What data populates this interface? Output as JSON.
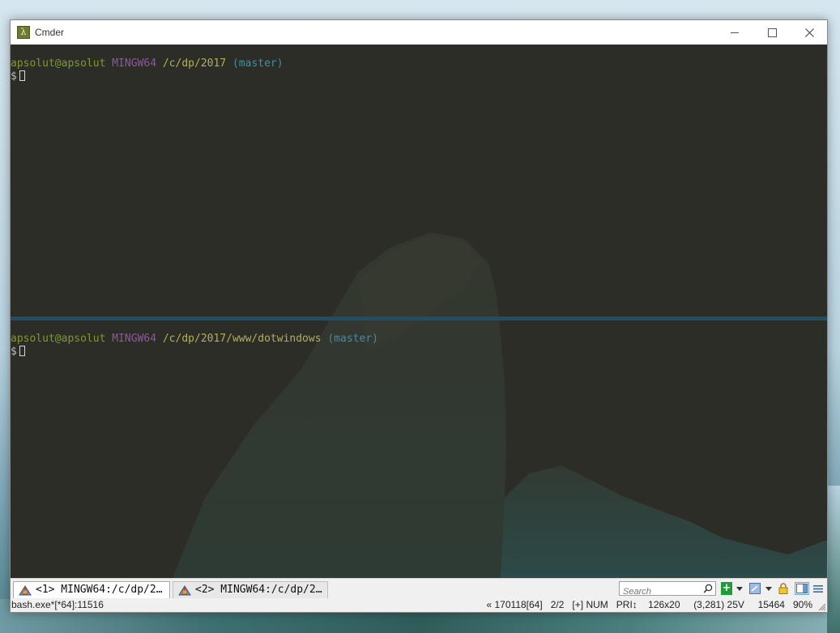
{
  "window": {
    "title": "Cmder",
    "app_icon_glyph": "λ"
  },
  "panes": [
    {
      "user_host": "apsolut@apsolut",
      "env": "MINGW64",
      "path": "/c/dp/2017",
      "branch": "(master)",
      "prompt": "$"
    },
    {
      "user_host": "apsolut@apsolut",
      "env": "MINGW64",
      "path": "/c/dp/2017/www/dotwindows",
      "branch": "(master)",
      "prompt": "$"
    }
  ],
  "tabs": [
    {
      "label": "<1> MINGW64:/c/dp/2…",
      "active": true
    },
    {
      "label": "<2> MINGW64:/c/dp/2…",
      "active": false
    }
  ],
  "toolbar": {
    "search_placeholder": "Search",
    "add_glyph": "+"
  },
  "status": {
    "process": "bash.exe*[*64]:11516",
    "build": "« 170118[64]",
    "console_index": "2/2",
    "insert_mode": "[+]",
    "num_lock": "NUM",
    "priority": "PRI↕",
    "size": "126x20",
    "cursor_pos": "(3,281) 25V",
    "pid": "15464",
    "transparency": "90%"
  },
  "colors": {
    "console_bg": "#2c2d27",
    "user": "#7d9b2b",
    "host": "#8a5a9a",
    "path": "#b3b05a",
    "branch": "#3c8fa6",
    "splitter": "#1f4f66"
  }
}
